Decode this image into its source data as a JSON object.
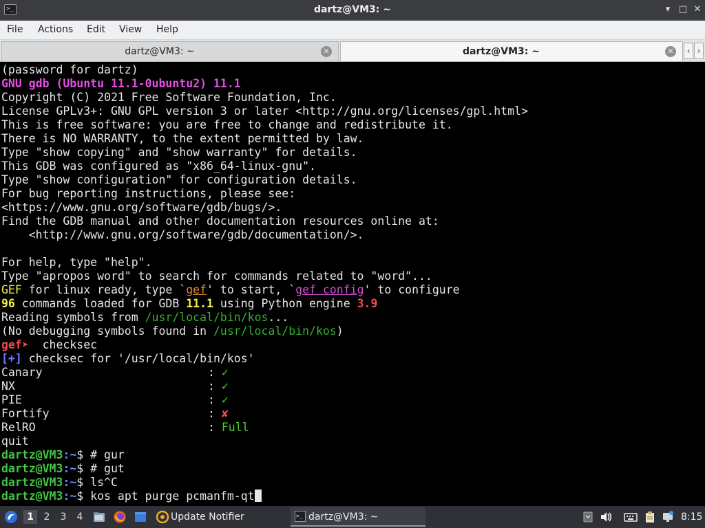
{
  "window": {
    "title": "dartz@VM3: ~"
  },
  "menu": [
    "File",
    "Actions",
    "Edit",
    "View",
    "Help"
  ],
  "tabs": [
    {
      "label": "dartz@VM3: ~",
      "active": false
    },
    {
      "label": "dartz@VM3: ~",
      "active": true
    }
  ],
  "terminal": {
    "l1": "(password for dartz)",
    "l2": "GNU gdb (Ubuntu 11.1-0ubuntu2) 11.1",
    "l3": "Copyright (C) 2021 Free Software Foundation, Inc.",
    "l4": "License GPLv3+: GNU GPL version 3 or later <http://gnu.org/licenses/gpl.html>",
    "l5": "This is free software: you are free to change and redistribute it.",
    "l6": "There is NO WARRANTY, to the extent permitted by law.",
    "l7": "Type \"show copying\" and \"show warranty\" for details.",
    "l8": "This GDB was configured as \"x86_64-linux-gnu\".",
    "l9": "Type \"show configuration\" for configuration details.",
    "l10": "For bug reporting instructions, please see:",
    "l11": "<https://www.gnu.org/software/gdb/bugs/>.",
    "l12": "Find the GDB manual and other documentation resources online at:",
    "l13": "    <http://www.gnu.org/software/gdb/documentation/>.",
    "l14": "For help, type \"help\".",
    "l15": "Type \"apropos word\" to search for commands related to \"word\"...",
    "gef_ready": {
      "gef": "GEF",
      "t1": " for linux ready, type `",
      "cmd1": "gef",
      "t2": "' to start, `",
      "cmd2": "gef config",
      "t3": "' to configure"
    },
    "loaded": {
      "count": "96",
      "t1": " commands loaded for GDB ",
      "gdb_ver": "11.1",
      "t2": " using Python engine ",
      "py_ver": "3.9"
    },
    "reading": {
      "t1": "Reading symbols from ",
      "path": "/usr/local/bin/kos",
      "t2": "..."
    },
    "nodebug": {
      "t1": "(No debugging symbols found in ",
      "path": "/usr/local/bin/kos",
      "t2": ")"
    },
    "gef_prompt": {
      "prompt": "gef➤",
      "cmd": "  checksec"
    },
    "checksec_head": {
      "tag": "[+]",
      "text": " checksec for '/usr/local/bin/kos'"
    },
    "checksec": [
      {
        "name": "Canary",
        "value": "✓"
      },
      {
        "name": "NX",
        "value": "✓"
      },
      {
        "name": "PIE",
        "value": "✓"
      },
      {
        "name": "Fortify",
        "value": "✘"
      },
      {
        "name": "RelRO",
        "value": "Full"
      }
    ],
    "checksec_sep": ": ",
    "quit": "quit",
    "prompt_user": "dartz@VM3",
    "prompt_path": ":~",
    "prompt_dollar": "$ ",
    "history": [
      "# gur",
      "# gut",
      "ls^C",
      "kos apt purge pcmanfm-qt"
    ]
  },
  "taskbar": {
    "desktops": [
      "1",
      "2",
      "3",
      "4"
    ],
    "active_desktop": "1",
    "tasks": [
      {
        "label": "Update Notifier"
      },
      {
        "label": "dartz@VM3: ~"
      }
    ],
    "clock": "8:15"
  }
}
